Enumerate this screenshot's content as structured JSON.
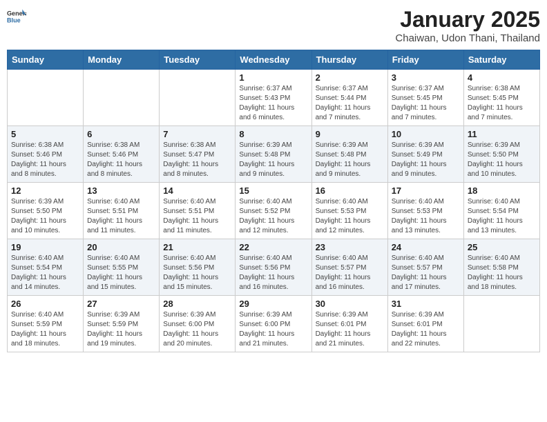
{
  "header": {
    "logo_general": "General",
    "logo_blue": "Blue",
    "title": "January 2025",
    "subtitle": "Chaiwan, Udon Thani, Thailand"
  },
  "days_of_week": [
    "Sunday",
    "Monday",
    "Tuesday",
    "Wednesday",
    "Thursday",
    "Friday",
    "Saturday"
  ],
  "weeks": [
    {
      "days": [
        {
          "number": "",
          "sunrise": "",
          "sunset": "",
          "daylight": "",
          "empty": true
        },
        {
          "number": "",
          "sunrise": "",
          "sunset": "",
          "daylight": "",
          "empty": true
        },
        {
          "number": "",
          "sunrise": "",
          "sunset": "",
          "daylight": "",
          "empty": true
        },
        {
          "number": "1",
          "sunrise": "Sunrise: 6:37 AM",
          "sunset": "Sunset: 5:43 PM",
          "daylight": "Daylight: 11 hours and 6 minutes."
        },
        {
          "number": "2",
          "sunrise": "Sunrise: 6:37 AM",
          "sunset": "Sunset: 5:44 PM",
          "daylight": "Daylight: 11 hours and 7 minutes."
        },
        {
          "number": "3",
          "sunrise": "Sunrise: 6:37 AM",
          "sunset": "Sunset: 5:45 PM",
          "daylight": "Daylight: 11 hours and 7 minutes."
        },
        {
          "number": "4",
          "sunrise": "Sunrise: 6:38 AM",
          "sunset": "Sunset: 5:45 PM",
          "daylight": "Daylight: 11 hours and 7 minutes."
        }
      ]
    },
    {
      "days": [
        {
          "number": "5",
          "sunrise": "Sunrise: 6:38 AM",
          "sunset": "Sunset: 5:46 PM",
          "daylight": "Daylight: 11 hours and 8 minutes."
        },
        {
          "number": "6",
          "sunrise": "Sunrise: 6:38 AM",
          "sunset": "Sunset: 5:46 PM",
          "daylight": "Daylight: 11 hours and 8 minutes."
        },
        {
          "number": "7",
          "sunrise": "Sunrise: 6:38 AM",
          "sunset": "Sunset: 5:47 PM",
          "daylight": "Daylight: 11 hours and 8 minutes."
        },
        {
          "number": "8",
          "sunrise": "Sunrise: 6:39 AM",
          "sunset": "Sunset: 5:48 PM",
          "daylight": "Daylight: 11 hours and 9 minutes."
        },
        {
          "number": "9",
          "sunrise": "Sunrise: 6:39 AM",
          "sunset": "Sunset: 5:48 PM",
          "daylight": "Daylight: 11 hours and 9 minutes."
        },
        {
          "number": "10",
          "sunrise": "Sunrise: 6:39 AM",
          "sunset": "Sunset: 5:49 PM",
          "daylight": "Daylight: 11 hours and 9 minutes."
        },
        {
          "number": "11",
          "sunrise": "Sunrise: 6:39 AM",
          "sunset": "Sunset: 5:50 PM",
          "daylight": "Daylight: 11 hours and 10 minutes."
        }
      ]
    },
    {
      "days": [
        {
          "number": "12",
          "sunrise": "Sunrise: 6:39 AM",
          "sunset": "Sunset: 5:50 PM",
          "daylight": "Daylight: 11 hours and 10 minutes."
        },
        {
          "number": "13",
          "sunrise": "Sunrise: 6:40 AM",
          "sunset": "Sunset: 5:51 PM",
          "daylight": "Daylight: 11 hours and 11 minutes."
        },
        {
          "number": "14",
          "sunrise": "Sunrise: 6:40 AM",
          "sunset": "Sunset: 5:51 PM",
          "daylight": "Daylight: 11 hours and 11 minutes."
        },
        {
          "number": "15",
          "sunrise": "Sunrise: 6:40 AM",
          "sunset": "Sunset: 5:52 PM",
          "daylight": "Daylight: 11 hours and 12 minutes."
        },
        {
          "number": "16",
          "sunrise": "Sunrise: 6:40 AM",
          "sunset": "Sunset: 5:53 PM",
          "daylight": "Daylight: 11 hours and 12 minutes."
        },
        {
          "number": "17",
          "sunrise": "Sunrise: 6:40 AM",
          "sunset": "Sunset: 5:53 PM",
          "daylight": "Daylight: 11 hours and 13 minutes."
        },
        {
          "number": "18",
          "sunrise": "Sunrise: 6:40 AM",
          "sunset": "Sunset: 5:54 PM",
          "daylight": "Daylight: 11 hours and 13 minutes."
        }
      ]
    },
    {
      "days": [
        {
          "number": "19",
          "sunrise": "Sunrise: 6:40 AM",
          "sunset": "Sunset: 5:54 PM",
          "daylight": "Daylight: 11 hours and 14 minutes."
        },
        {
          "number": "20",
          "sunrise": "Sunrise: 6:40 AM",
          "sunset": "Sunset: 5:55 PM",
          "daylight": "Daylight: 11 hours and 15 minutes."
        },
        {
          "number": "21",
          "sunrise": "Sunrise: 6:40 AM",
          "sunset": "Sunset: 5:56 PM",
          "daylight": "Daylight: 11 hours and 15 minutes."
        },
        {
          "number": "22",
          "sunrise": "Sunrise: 6:40 AM",
          "sunset": "Sunset: 5:56 PM",
          "daylight": "Daylight: 11 hours and 16 minutes."
        },
        {
          "number": "23",
          "sunrise": "Sunrise: 6:40 AM",
          "sunset": "Sunset: 5:57 PM",
          "daylight": "Daylight: 11 hours and 16 minutes."
        },
        {
          "number": "24",
          "sunrise": "Sunrise: 6:40 AM",
          "sunset": "Sunset: 5:57 PM",
          "daylight": "Daylight: 11 hours and 17 minutes."
        },
        {
          "number": "25",
          "sunrise": "Sunrise: 6:40 AM",
          "sunset": "Sunset: 5:58 PM",
          "daylight": "Daylight: 11 hours and 18 minutes."
        }
      ]
    },
    {
      "days": [
        {
          "number": "26",
          "sunrise": "Sunrise: 6:40 AM",
          "sunset": "Sunset: 5:59 PM",
          "daylight": "Daylight: 11 hours and 18 minutes."
        },
        {
          "number": "27",
          "sunrise": "Sunrise: 6:39 AM",
          "sunset": "Sunset: 5:59 PM",
          "daylight": "Daylight: 11 hours and 19 minutes."
        },
        {
          "number": "28",
          "sunrise": "Sunrise: 6:39 AM",
          "sunset": "Sunset: 6:00 PM",
          "daylight": "Daylight: 11 hours and 20 minutes."
        },
        {
          "number": "29",
          "sunrise": "Sunrise: 6:39 AM",
          "sunset": "Sunset: 6:00 PM",
          "daylight": "Daylight: 11 hours and 21 minutes."
        },
        {
          "number": "30",
          "sunrise": "Sunrise: 6:39 AM",
          "sunset": "Sunset: 6:01 PM",
          "daylight": "Daylight: 11 hours and 21 minutes."
        },
        {
          "number": "31",
          "sunrise": "Sunrise: 6:39 AM",
          "sunset": "Sunset: 6:01 PM",
          "daylight": "Daylight: 11 hours and 22 minutes."
        },
        {
          "number": "",
          "sunrise": "",
          "sunset": "",
          "daylight": "",
          "empty": true
        }
      ]
    }
  ]
}
